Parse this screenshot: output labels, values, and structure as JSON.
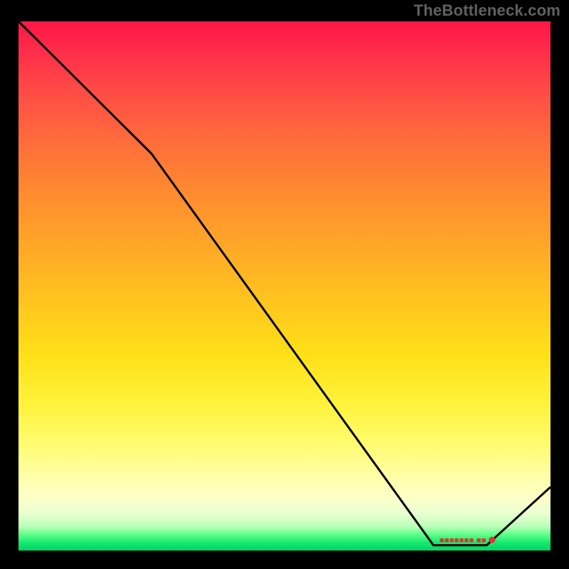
{
  "watermark": "TheBottleneck.com",
  "marker": {
    "label": "",
    "display_text": "■■■■■■■ ■■"
  },
  "colors": {
    "line": "#000000",
    "marker": "#e53030",
    "gradient_top": "#ff1744",
    "gradient_mid": "#ffe018",
    "gradient_bottom": "#00d563"
  },
  "chart_data": {
    "type": "line",
    "title": "",
    "xlabel": "",
    "ylabel": "",
    "xlim": [
      0,
      100
    ],
    "ylim": [
      0,
      100
    ],
    "series": [
      {
        "name": "curve",
        "x": [
          0,
          25,
          78,
          82,
          88,
          100
        ],
        "y": [
          100,
          75,
          1,
          1,
          1,
          12
        ]
      }
    ],
    "marker_point": {
      "x": 89,
      "y": 2,
      "label": ""
    }
  }
}
